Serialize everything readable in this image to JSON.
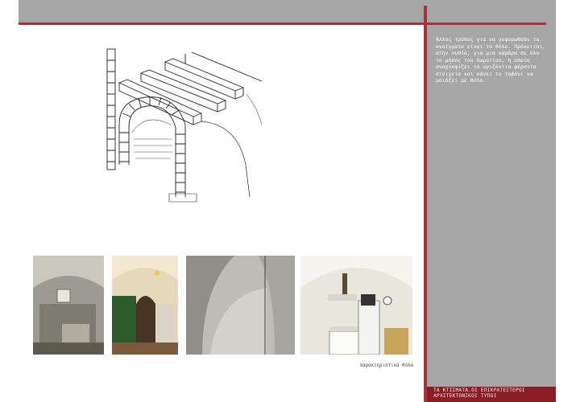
{
  "sidebar": {
    "paragraph": "Άλλος τρόπος για να γεφυρωθούν τα ανοίγματα είναι το θόλο. Πρόκειται, στην ουσία, για μια καμάρα σε όλο το μήκος του δωματίου, η οποία αναχουφίζει τα οριζόντια φέροντα στοιχεία και κάνει το ταβάνι να μοιάζει με θόλο."
  },
  "footer": {
    "line1": "ΤΑ ΚΤΙΣΜΑΤΑ.ΟΙ ΕΠΙΚΡΑΤΕΣΤΕΡΟΙ",
    "line2": "ΑΡΧΙΤΕΚΤΟΝΙΚΟΙ ΤΥΠΟΙ"
  },
  "caption": "Χαρακτηριστικά θόλα",
  "colors": {
    "accent_red": "#a8323a",
    "footer_red": "#8b1e22",
    "panel_gray": "#a6a6a6"
  }
}
